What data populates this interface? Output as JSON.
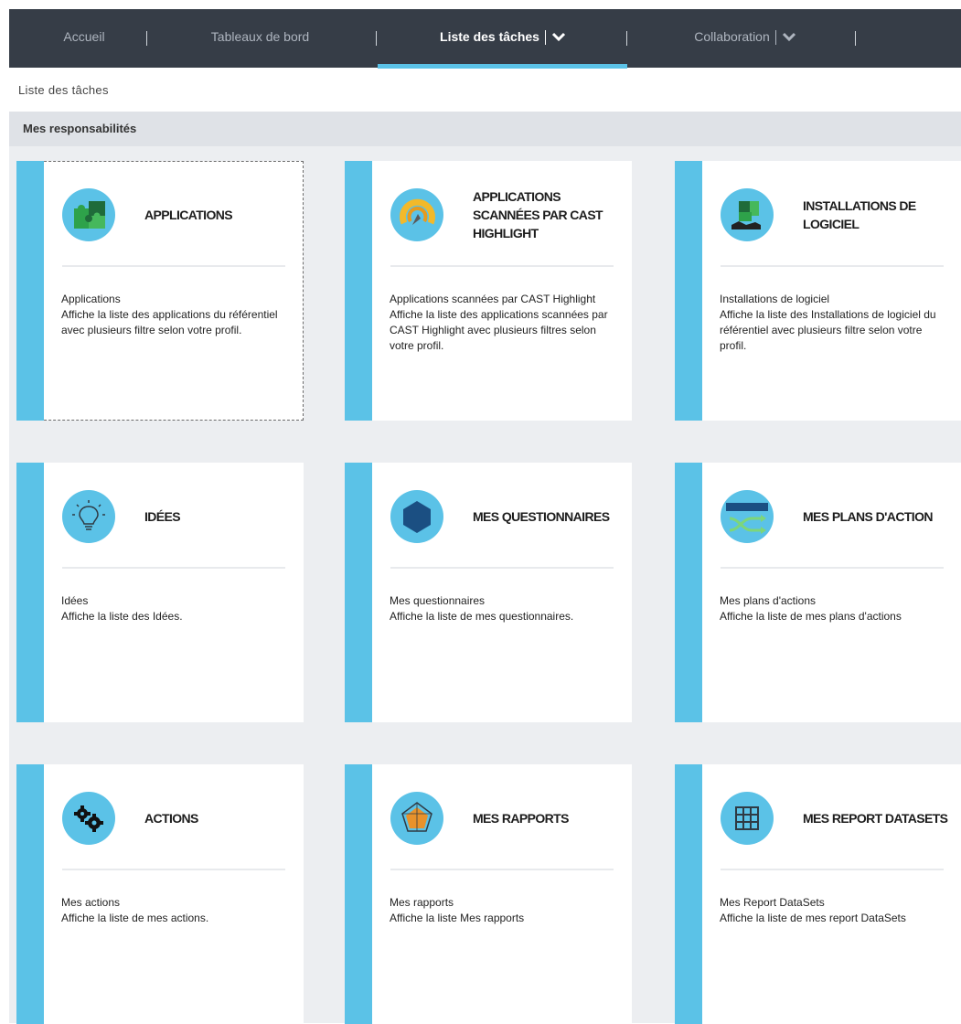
{
  "nav": {
    "items": [
      {
        "label": "Accueil"
      },
      {
        "label": "Tableaux de bord"
      },
      {
        "label": "Liste des tâches"
      },
      {
        "label": "Collaboration"
      }
    ],
    "active_index": 2
  },
  "breadcrumb": "Liste des tâches",
  "section": {
    "title": "Mes responsabilités"
  },
  "colors": {
    "nav_bg": "#363d47",
    "accent": "#5bc2e7",
    "content_bg": "#eceef1"
  },
  "cards": [
    {
      "icon": "puzzle-icon",
      "title": "APPLICATIONS",
      "subtitle": "Applications",
      "description": "Affiche la liste des applications du référentiel avec plusieurs filtre selon votre profil."
    },
    {
      "icon": "gauge-icon",
      "title": "APPLICATIONS SCANNÉES PAR CAST HIGHLIGHT",
      "subtitle": "Applications scannées par CAST Highlight",
      "description": "Affiche la liste des applications scannées par CAST Highlight avec plusieurs filtres selon votre profil."
    },
    {
      "icon": "software-install-icon",
      "title": "INSTALLATIONS DE LOGICIEL",
      "subtitle": "Installations de logiciel",
      "description": "Affiche la liste des Installations de logiciel du référentiel avec plusieurs filtre selon votre profil."
    },
    {
      "icon": "lightbulb-icon",
      "title": "IDÉES",
      "subtitle": "Idées",
      "description": "Affiche la liste des Idées."
    },
    {
      "icon": "hexagon-icon",
      "title": "MES QUESTIONNAIRES",
      "subtitle": "Mes questionnaires",
      "description": "Affiche la liste de mes questionnaires."
    },
    {
      "icon": "action-plan-icon",
      "title": "MES PLANS D'ACTION",
      "subtitle": "Mes plans d'actions",
      "description": "Affiche la liste de mes plans d'actions"
    },
    {
      "icon": "gears-icon",
      "title": "ACTIONS",
      "subtitle": "Mes actions",
      "description": "Affiche la liste de mes actions."
    },
    {
      "icon": "radar-chart-icon",
      "title": "MES RAPPORTS",
      "subtitle": "Mes rapports",
      "description": "Affiche la liste Mes rapports"
    },
    {
      "icon": "grid-table-icon",
      "title": "MES REPORT DATASETS",
      "subtitle": "Mes Report DataSets",
      "description": "Affiche la liste de mes report DataSets"
    }
  ]
}
